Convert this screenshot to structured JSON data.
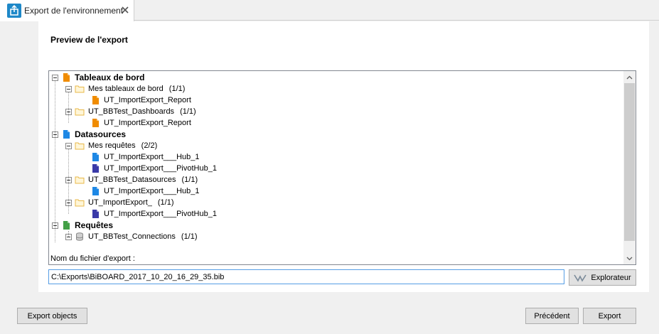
{
  "tab": {
    "title": "Export de l'environnement"
  },
  "preview": {
    "title": "Preview de l'export"
  },
  "tree": [
    {
      "label": "Tableaux de bord",
      "count": "",
      "bold": true,
      "icon": "dashboard-root-icon",
      "color": "#f08c00"
    },
    {
      "label": "Mes tableaux de bord",
      "count": "(1/1)",
      "bold": false,
      "icon": "folder-icon"
    },
    {
      "label": "UT_ImportExport_Report",
      "count": "",
      "bold": false,
      "icon": "report-icon",
      "color": "#f08c00"
    },
    {
      "label": "UT_BBTest_Dashboards",
      "count": "(1/1)",
      "bold": false,
      "icon": "folder-icon"
    },
    {
      "label": "UT_ImportExport_Report",
      "count": "",
      "bold": false,
      "icon": "report-icon",
      "color": "#f08c00"
    },
    {
      "label": "Datasources",
      "count": "",
      "bold": true,
      "icon": "datasource-root-icon",
      "color": "#1e88e5"
    },
    {
      "label": "Mes requêtes",
      "count": "(2/2)",
      "bold": false,
      "icon": "folder-icon"
    },
    {
      "label": "UT_ImportExport___Hub_1",
      "count": "",
      "bold": false,
      "icon": "hub-icon",
      "color": "#1e88e5"
    },
    {
      "label": "UT_ImportExport___PivotHub_1",
      "count": "",
      "bold": false,
      "icon": "pivothub-icon",
      "color": "#3a3aa8"
    },
    {
      "label": "UT_BBTest_Datasources",
      "count": "(1/1)",
      "bold": false,
      "icon": "folder-icon"
    },
    {
      "label": "UT_ImportExport___Hub_1",
      "count": "",
      "bold": false,
      "icon": "hub-icon",
      "color": "#1e88e5"
    },
    {
      "label": "UT_ImportExport_",
      "count": "(1/1)",
      "bold": false,
      "icon": "folder-icon"
    },
    {
      "label": "UT_ImportExport___PivotHub_1",
      "count": "",
      "bold": false,
      "icon": "pivothub-icon",
      "color": "#3a3aa8"
    },
    {
      "label": "Requêtes",
      "count": "",
      "bold": true,
      "icon": "query-root-icon",
      "color": "#43a047"
    },
    {
      "label": "UT_BBTest_Connections",
      "count": "(1/1)",
      "bold": false,
      "icon": "database-icon"
    }
  ],
  "file": {
    "label": "Nom du fichier d'export :",
    "value": "C:\\Exports\\BiBOARD_2017_10_20_16_29_35.bib"
  },
  "buttons": {
    "explorer": "Explorateur",
    "export_objects": "Export objects",
    "previous": "Précédent",
    "export": "Export"
  }
}
